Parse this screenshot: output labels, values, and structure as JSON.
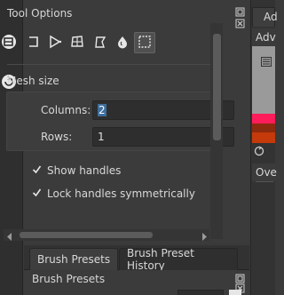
{
  "left_toolbox": {
    "tools": [
      {
        "icon": "crop-icon"
      },
      {
        "icon": "reload-icon"
      }
    ]
  },
  "tool_options": {
    "title": "Tool Options",
    "transform_modes": [
      {
        "icon": "free-transform-icon",
        "active": false
      },
      {
        "icon": "perspective-icon",
        "active": false
      },
      {
        "icon": "warp-icon",
        "active": false
      },
      {
        "icon": "cage-icon",
        "active": false
      },
      {
        "icon": "liquify-icon",
        "active": false
      },
      {
        "icon": "mesh-icon",
        "active": true
      }
    ],
    "mesh_size_label": "Mesh size",
    "columns_label": "Columns:",
    "columns_value": "2",
    "rows_label": "Rows:",
    "rows_value": "1",
    "show_handles_label": "Show handles",
    "show_handles_checked": true,
    "lock_handles_label": "Lock handles symmetrically",
    "lock_handles_checked": true
  },
  "right_panel": {
    "tab_label": "Ad",
    "advanced_label": "Adv",
    "overview_label": "Ove",
    "swatch_colors": [
      "#9a9a9a",
      "#ff1c5a",
      "#8c2a10",
      "#c43a0a"
    ]
  },
  "brush_tabs": [
    {
      "label": "Brush Presets",
      "active": true
    },
    {
      "label": "Brush Preset History",
      "active": false
    }
  ],
  "brush_presets": {
    "title": "Brush Presets"
  }
}
